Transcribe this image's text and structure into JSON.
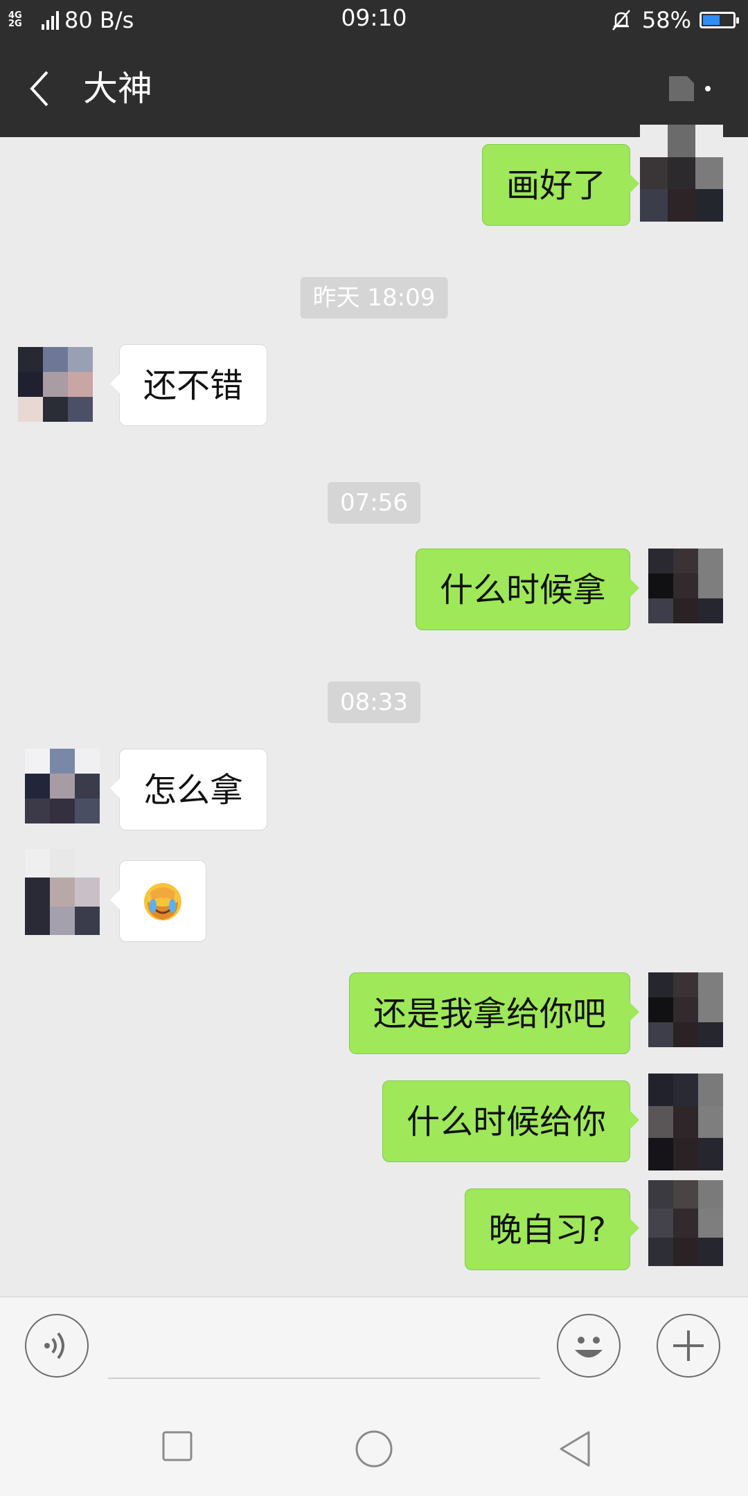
{
  "status_bar": {
    "network": "4G",
    "network_sub": "2G",
    "speed": "80 B/s",
    "time": "09:10",
    "battery_percent": "58%",
    "battery_level": 0.58,
    "icons": [
      "signal-icon",
      "mute-icon",
      "battery-icon"
    ]
  },
  "header": {
    "title": "大神",
    "back_icon": "chevron-left-icon",
    "profile_icon": "profile-icon"
  },
  "messages": [
    {
      "type": "out",
      "text": "画好了"
    },
    {
      "type": "time",
      "text": "昨天 18:09"
    },
    {
      "type": "in",
      "text": "还不错"
    },
    {
      "type": "time",
      "text": "07:56"
    },
    {
      "type": "out",
      "text": "什么时候拿"
    },
    {
      "type": "time",
      "text": "08:33"
    },
    {
      "type": "in",
      "text": "怎么拿"
    },
    {
      "type": "in",
      "text": "😭",
      "emoji": "facepalm-crying-emoji"
    },
    {
      "type": "out",
      "text": "还是我拿给你吧"
    },
    {
      "type": "out",
      "text": "什么时候给你"
    },
    {
      "type": "out",
      "text": "晚自习?"
    }
  ],
  "input_bar": {
    "voice_icon": "voice-icon",
    "emoji_icon": "smiley-icon",
    "add_icon": "plus-icon",
    "text_value": ""
  },
  "nav_bar": {
    "icons": [
      "recent-apps-icon",
      "home-icon",
      "back-icon"
    ]
  },
  "colors": {
    "header_bg": "#2e2e2e",
    "chat_bg": "#ebebeb",
    "out_bubble": "#9ee85a",
    "in_bubble": "#ffffff",
    "timestamp_bg": "#d5d5d5"
  }
}
